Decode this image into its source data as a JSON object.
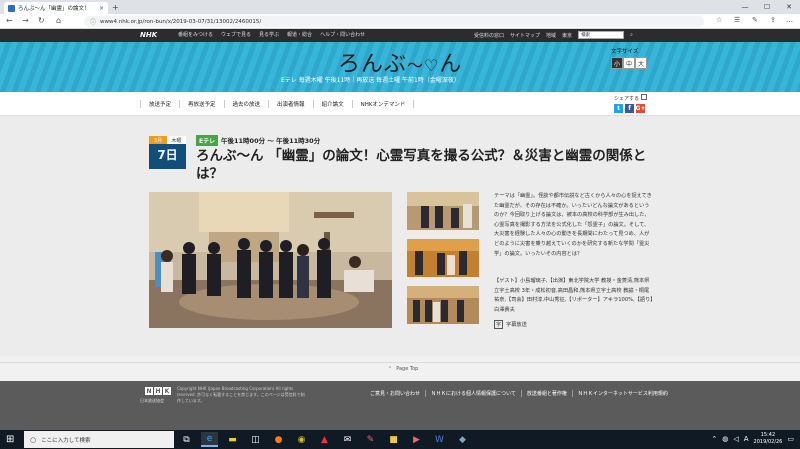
{
  "browser": {
    "tab_title": "ろんぶ〜ん「幽霊」の論文！",
    "tab_close": "×",
    "new_tab": "+",
    "window_controls": [
      "—",
      "☐",
      "✕"
    ],
    "url": "www4.nhk.or.jp/ron-bun/x/2019-03-07/31/13002/2460015/"
  },
  "nhk_header": {
    "logo": "NHK",
    "global_nav": [
      "番組をみつける",
      "ウェブで見る",
      "見る学ぶ",
      "報道・総合",
      "ヘルプ・問い合わせ"
    ],
    "right_nav": [
      "受信料の窓口",
      "サイトマップ",
      "地域"
    ],
    "region_value": "東京",
    "search_placeholder": "検索"
  },
  "banner": {
    "logo_prefix": "ろんぶ",
    "logo_heart": "〜♡",
    "logo_suffix": "ん",
    "subline": "Eテレ 毎週木曜 午後11時｜再放送 毎週土曜 午前1時（金曜深夜）",
    "font_size_label": "文字サイズ",
    "font_sizes": [
      "小",
      "中",
      "大"
    ]
  },
  "subnav": {
    "items": [
      "放送予定",
      "再放送予定",
      "過去の放送",
      "出演者情報",
      "紹介論文",
      "NHKオンデマンド"
    ],
    "share_label": "シェアする",
    "share_icons": [
      "t",
      "f",
      "G+"
    ]
  },
  "episode": {
    "month": "3月",
    "weekday": "木曜",
    "day": "7日",
    "channel": "Eテレ",
    "airtime": "午後11時00分 ～ 午後11時30分",
    "title": "ろんぶ〜ん 「幽霊」の論文！心霊写真を撮る公式？＆災害と幽霊の関係とは？",
    "description": "テーマは「幽霊」。怪談や都市伝説など古くから人々の心を捉えてきた幽霊だが、その存在は不確か。いったいどんな論文があるというのか？今回取り上げる論文は、被本の高校の科学部が生み出した、心霊写真を撮影する方法を公式化した「怨霊子」の論文。そして、大災害を経験した人々の心の動きを長期間にわたって見つめ、人がどのように災害を乗り越えていくのかを研究する新たな学問「霊災学」の論文。いったいその内容とは？",
    "guests": "【ゲスト】小島瑠璃子,【出演】東北学院大学 教授・金菱清,熊本県立宇土高校 3年・成松初音,高田昌和,熊本県立宇土高校 教諭・桐尾祐奈,【司会】田村淳,中山秀征,【リポーター】アキラ100%,【語り】白澤貴夫",
    "subtitle_badge": "字",
    "subtitle_label": "字幕放送"
  },
  "page_top": "Page Top",
  "footer": {
    "logo_letters": [
      "N",
      "H",
      "K"
    ],
    "logo_sub": "日本放送協会",
    "copyright": "Copyright NHK (Japan Broadcasting Corporation) All rights reserved. 許可なく転載することを禁じます。このページは受信料で制作しています。",
    "links": [
      "ご意見・お問い合わせ",
      "ＮＨＫにおける個人情報保護について",
      "放送番組と著作権",
      "ＮＨＫインターネットサービス利用規約"
    ]
  },
  "taskbar": {
    "search_placeholder": "ここに入力して検索",
    "time": "15:42",
    "date": "2019/02/26"
  }
}
